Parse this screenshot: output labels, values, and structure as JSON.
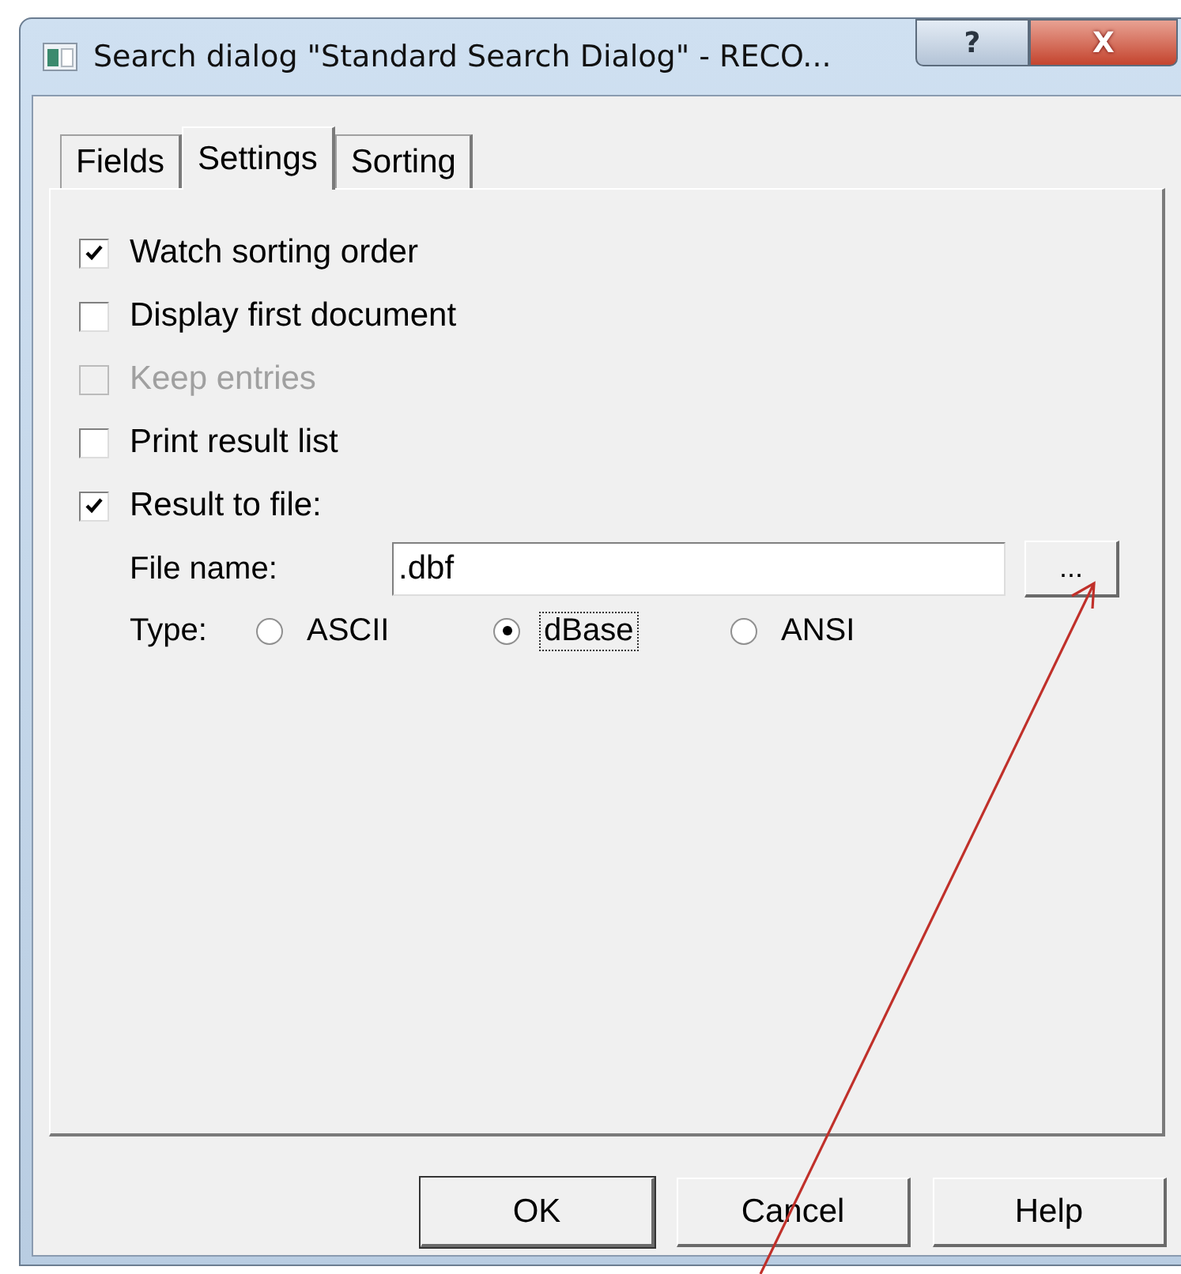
{
  "window": {
    "title": "Search dialog \"Standard Search Dialog\" - RECO...",
    "help_button": "?",
    "close_button": "X"
  },
  "tabs": [
    {
      "label": "Fields",
      "selected": false
    },
    {
      "label": "Settings",
      "selected": true
    },
    {
      "label": "Sorting",
      "selected": false
    }
  ],
  "options": [
    {
      "label": "Watch sorting order",
      "checked": true,
      "disabled": false
    },
    {
      "label": "Display first document",
      "checked": false,
      "disabled": false
    },
    {
      "label": "Keep entries",
      "checked": false,
      "disabled": true
    },
    {
      "label": "Print result list",
      "checked": false,
      "disabled": false
    },
    {
      "label": "Result to file:",
      "checked": true,
      "disabled": false
    }
  ],
  "file_name": {
    "label": "File name:",
    "value": ".dbf",
    "browse_button": "..."
  },
  "type": {
    "label": "Type:",
    "choices": [
      {
        "label": "ASCII",
        "selected": false
      },
      {
        "label": "dBase",
        "selected": true
      },
      {
        "label": "ANSI",
        "selected": false
      }
    ]
  },
  "buttons": [
    "OK",
    "Cancel",
    "Help"
  ]
}
